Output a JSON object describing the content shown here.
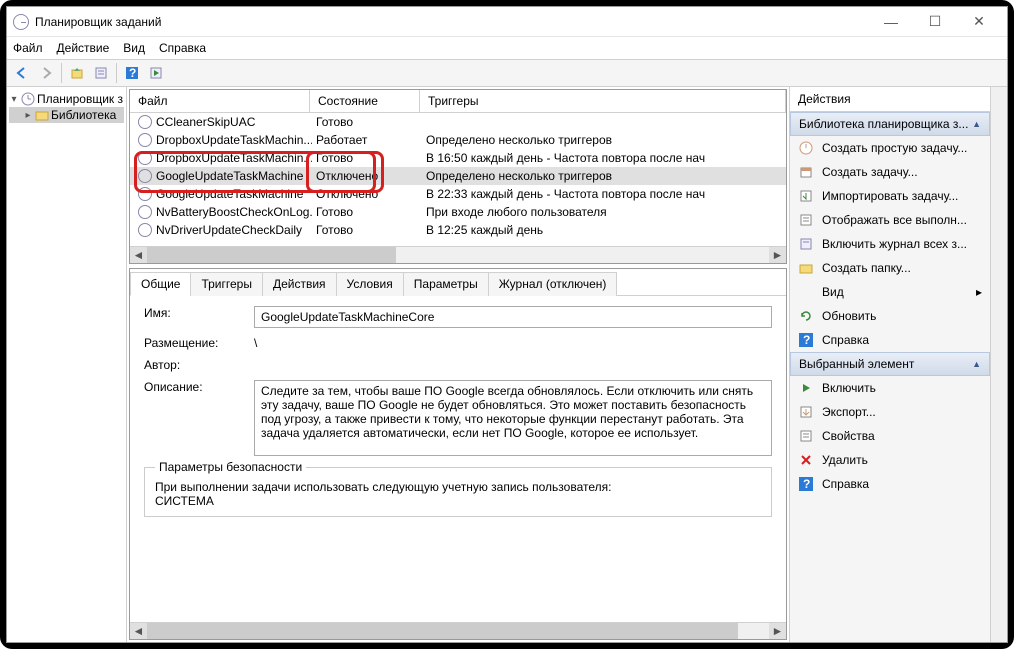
{
  "window": {
    "title": "Планировщик заданий"
  },
  "menu": {
    "file": "Файл",
    "action": "Действие",
    "view": "Вид",
    "help": "Справка"
  },
  "tree": {
    "root": "Планировщик з",
    "lib": "Библиотека"
  },
  "list": {
    "headers": {
      "file": "Файл",
      "state": "Состояние",
      "triggers": "Триггеры"
    },
    "rows": [
      {
        "name": "CCleanerSkipUAC",
        "state": "Готово",
        "trig": ""
      },
      {
        "name": "DropboxUpdateTaskMachin...",
        "state": "Работает",
        "trig": "Определено несколько триггеров"
      },
      {
        "name": "DropboxUpdateTaskMachin...",
        "state": "Готово",
        "trig": "В 16:50 каждый день - Частота повтора после нач"
      },
      {
        "name": "GoogleUpdateTaskMachine",
        "state": "Отключено",
        "trig": "Определено несколько триггеров"
      },
      {
        "name": "GoogleUpdateTaskMachine",
        "state": "Отключено",
        "trig": "В 22:33 каждый день - Частота повтора после нач"
      },
      {
        "name": "NvBatteryBoostCheckOnLog...",
        "state": "Готово",
        "trig": "При входе любого пользователя"
      },
      {
        "name": "NvDriverUpdateCheckDaily",
        "state": "Готово",
        "trig": "В 12:25 каждый день"
      }
    ]
  },
  "tabs": {
    "general": "Общие",
    "triggers": "Триггеры",
    "actions": "Действия",
    "conditions": "Условия",
    "settings": "Параметры",
    "history": "Журнал (отключен)"
  },
  "detail": {
    "name_lbl": "Имя:",
    "name_val": "GoogleUpdateTaskMachineCore",
    "location_lbl": "Размещение:",
    "location_val": "\\",
    "author_lbl": "Автор:",
    "author_val": "",
    "desc_lbl": "Описание:",
    "desc_val": "Следите за тем, чтобы ваше ПО Google всегда обновлялось. Если отключить или снять эту задачу, ваше ПО Google не будет обновляться. Это может поставить безопасность под угрозу, а также привести к тому, что некоторые функции перестанут работать. Эта задача удаляется автоматически, если нет ПО Google, которое ее использует.",
    "sec_title": "Параметры безопасности",
    "sec_run_as": "При выполнении задачи использовать следующую учетную запись пользователя:",
    "sec_account": "СИСТЕМА"
  },
  "actions": {
    "title": "Действия",
    "section1": "Библиотека планировщика з...",
    "items1": [
      "Создать простую задачу...",
      "Создать задачу...",
      "Импортировать задачу...",
      "Отображать все выполн...",
      "Включить журнал всех з...",
      "Создать папку..."
    ],
    "view": "Вид",
    "refresh": "Обновить",
    "help1": "Справка",
    "section2": "Выбранный элемент",
    "items2": [
      "Включить",
      "Экспорт...",
      "Свойства",
      "Удалить",
      "Справка"
    ]
  }
}
